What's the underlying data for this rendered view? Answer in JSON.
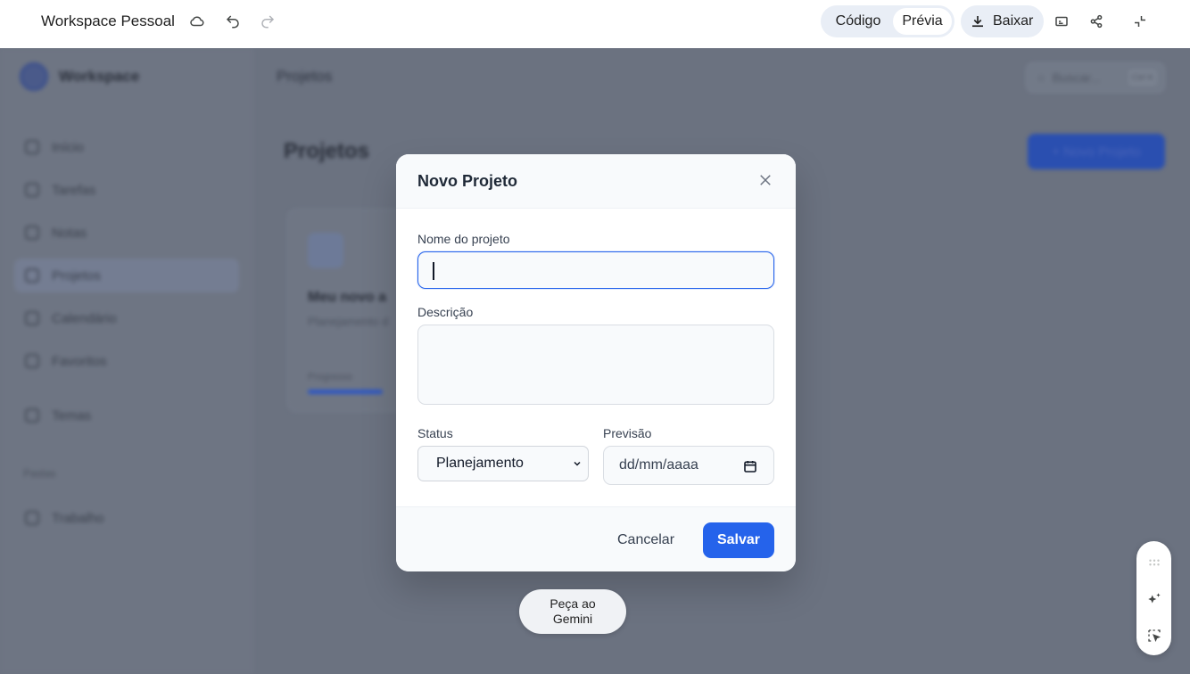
{
  "topbar": {
    "title": "Workspace Pessoal",
    "mode_code": "Código",
    "mode_preview": "Prévia",
    "download_label": "Baixar"
  },
  "app": {
    "brand": "Workspace",
    "header_title": "Projetos",
    "search_placeholder": "Buscar...",
    "search_shortcut": "Ctrl K",
    "nav": [
      {
        "label": "Início"
      },
      {
        "label": "Tarefas"
      },
      {
        "label": "Notas"
      },
      {
        "label": "Projetos"
      },
      {
        "label": "Calendário"
      },
      {
        "label": "Favoritos"
      },
      {
        "label": "Temas"
      }
    ],
    "section_label": "Pastas",
    "folder_item": "Trabalho",
    "page_heading": "Projetos",
    "new_project_label": "+ Novo Projeto",
    "card": {
      "title": "Meu novo a",
      "subtitle": "Planejamento d",
      "progress_label": "Progresso",
      "progress": 0.25
    }
  },
  "modal": {
    "title": "Novo Projeto",
    "name_label": "Nome do projeto",
    "name_value": "",
    "description_label": "Descrição",
    "description_value": "",
    "status_label": "Status",
    "status_value": "Planejamento",
    "forecast_label": "Previsão",
    "forecast_placeholder": "dd/mm/aaaa",
    "cancel_label": "Cancelar",
    "save_label": "Salvar"
  },
  "gemini": {
    "line1": "Peça ao",
    "line2": "Gemini"
  },
  "colors": {
    "accent": "#2563eb",
    "overlay": "#6b7280"
  }
}
